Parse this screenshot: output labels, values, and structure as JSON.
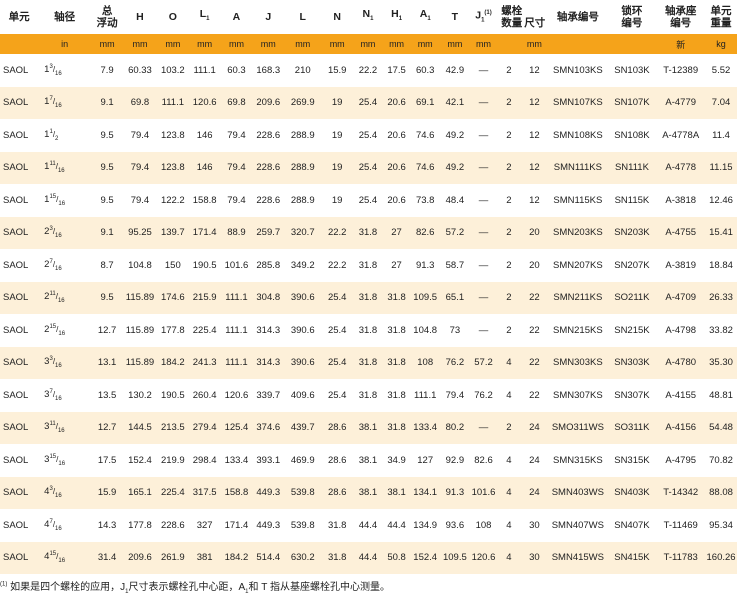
{
  "headers": {
    "unit": "单元",
    "bore": "轴径",
    "float": "总\n浮动",
    "H": "H",
    "O": "O",
    "L1": "L",
    "A": "A",
    "J": "J",
    "L": "L",
    "N": "N",
    "N1": "N",
    "H1": "H",
    "A1": "A",
    "T": "T",
    "J1": "J",
    "J1_sup": "(1)",
    "bolt_count": "螺栓\n数量",
    "bolt_size": "尺寸",
    "bearing": "轴承编号",
    "lock_ring": "锁环\n编号",
    "housing": "轴承座\n编号",
    "unit_weight": "单元\n重量",
    "sub1": "1"
  },
  "units": {
    "in": "in",
    "mm": "mm",
    "housing_new": "新",
    "kg": "kg"
  },
  "rows": [
    {
      "unit": "SAOL",
      "bore_whole": "1",
      "bore_num": "3",
      "bore_den": "16",
      "float": "7.9",
      "H": "60.33",
      "O": "103.2",
      "L1": "111.1",
      "A": "60.3",
      "J": "168.3",
      "L": "210",
      "N": "15.9",
      "N1": "22.2",
      "H1": "17.5",
      "A1": "60.3",
      "T": "42.9",
      "J1": "—",
      "bolt_count": "2",
      "bolt_size": "12",
      "bearing": "SMN103KS",
      "lock_ring": "SN103K",
      "housing": "T-12389",
      "weight": "5.52"
    },
    {
      "unit": "SAOL",
      "bore_whole": "1",
      "bore_num": "7",
      "bore_den": "16",
      "float": "9.1",
      "H": "69.8",
      "O": "111.1",
      "L1": "120.6",
      "A": "69.8",
      "J": "209.6",
      "L": "269.9",
      "N": "19",
      "N1": "25.4",
      "H1": "20.6",
      "A1": "69.1",
      "T": "42.1",
      "J1": "—",
      "bolt_count": "2",
      "bolt_size": "12",
      "bearing": "SMN107KS",
      "lock_ring": "SN107K",
      "housing": "A-4779",
      "weight": "7.04"
    },
    {
      "unit": "SAOL",
      "bore_whole": "1",
      "bore_num": "1",
      "bore_den": "2",
      "float": "9.5",
      "H": "79.4",
      "O": "123.8",
      "L1": "146",
      "A": "79.4",
      "J": "228.6",
      "L": "288.9",
      "N": "19",
      "N1": "25.4",
      "H1": "20.6",
      "A1": "74.6",
      "T": "49.2",
      "J1": "—",
      "bolt_count": "2",
      "bolt_size": "12",
      "bearing": "SMN108KS",
      "lock_ring": "SN108K",
      "housing": "A-4778A",
      "weight": "11.4"
    },
    {
      "unit": "SAOL",
      "bore_whole": "1",
      "bore_num": "11",
      "bore_den": "16",
      "float": "9.5",
      "H": "79.4",
      "O": "123.8",
      "L1": "146",
      "A": "79.4",
      "J": "228.6",
      "L": "288.9",
      "N": "19",
      "N1": "25.4",
      "H1": "20.6",
      "A1": "74.6",
      "T": "49.2",
      "J1": "—",
      "bolt_count": "2",
      "bolt_size": "12",
      "bearing": "SMN111KS",
      "lock_ring": "SN111K",
      "housing": "A-4778",
      "weight": "11.15"
    },
    {
      "unit": "SAOL",
      "bore_whole": "1",
      "bore_num": "15",
      "bore_den": "16",
      "float": "9.5",
      "H": "79.4",
      "O": "122.2",
      "L1": "158.8",
      "A": "79.4",
      "J": "228.6",
      "L": "288.9",
      "N": "19",
      "N1": "25.4",
      "H1": "20.6",
      "A1": "73.8",
      "T": "48.4",
      "J1": "—",
      "bolt_count": "2",
      "bolt_size": "12",
      "bearing": "SMN115KS",
      "lock_ring": "SN115K",
      "housing": "A-3818",
      "weight": "12.46"
    },
    {
      "unit": "SAOL",
      "bore_whole": "2",
      "bore_num": "3",
      "bore_den": "16",
      "float": "9.1",
      "H": "95.25",
      "O": "139.7",
      "L1": "171.4",
      "A": "88.9",
      "J": "259.7",
      "L": "320.7",
      "N": "22.2",
      "N1": "31.8",
      "H1": "27",
      "A1": "82.6",
      "T": "57.2",
      "J1": "—",
      "bolt_count": "2",
      "bolt_size": "20",
      "bearing": "SMN203KS",
      "lock_ring": "SN203K",
      "housing": "A-4755",
      "weight": "15.41"
    },
    {
      "unit": "SAOL",
      "bore_whole": "2",
      "bore_num": "7",
      "bore_den": "16",
      "float": "8.7",
      "H": "104.8",
      "O": "150",
      "L1": "190.5",
      "A": "101.6",
      "J": "285.8",
      "L": "349.2",
      "N": "22.2",
      "N1": "31.8",
      "H1": "27",
      "A1": "91.3",
      "T": "58.7",
      "J1": "—",
      "bolt_count": "2",
      "bolt_size": "20",
      "bearing": "SMN207KS",
      "lock_ring": "SN207K",
      "housing": "A-3819",
      "weight": "18.84"
    },
    {
      "unit": "SAOL",
      "bore_whole": "2",
      "bore_num": "11",
      "bore_den": "16",
      "float": "9.5",
      "H": "115.89",
      "O": "174.6",
      "L1": "215.9",
      "A": "111.1",
      "J": "304.8",
      "L": "390.6",
      "N": "25.4",
      "N1": "31.8",
      "H1": "31.8",
      "A1": "109.5",
      "T": "65.1",
      "J1": "—",
      "bolt_count": "2",
      "bolt_size": "22",
      "bearing": "SMN211KS",
      "lock_ring": "SO211K",
      "housing": "A-4709",
      "weight": "26.33"
    },
    {
      "unit": "SAOL",
      "bore_whole": "2",
      "bore_num": "15",
      "bore_den": "16",
      "float": "12.7",
      "H": "115.89",
      "O": "177.8",
      "L1": "225.4",
      "A": "111.1",
      "J": "314.3",
      "L": "390.6",
      "N": "25.4",
      "N1": "31.8",
      "H1": "31.8",
      "A1": "104.8",
      "T": "73",
      "J1": "—",
      "bolt_count": "2",
      "bolt_size": "22",
      "bearing": "SMN215KS",
      "lock_ring": "SN215K",
      "housing": "A-4798",
      "weight": "33.82"
    },
    {
      "unit": "SAOL",
      "bore_whole": "3",
      "bore_num": "3",
      "bore_den": "16",
      "float": "13.1",
      "H": "115.89",
      "O": "184.2",
      "L1": "241.3",
      "A": "111.1",
      "J": "314.3",
      "L": "390.6",
      "N": "25.4",
      "N1": "31.8",
      "H1": "31.8",
      "A1": "108",
      "T": "76.2",
      "J1": "57.2",
      "bolt_count": "4",
      "bolt_size": "22",
      "bearing": "SMN303KS",
      "lock_ring": "SN303K",
      "housing": "A-4780",
      "weight": "35.30"
    },
    {
      "unit": "SAOL",
      "bore_whole": "3",
      "bore_num": "7",
      "bore_den": "16",
      "float": "13.5",
      "H": "130.2",
      "O": "190.5",
      "L1": "260.4",
      "A": "120.6",
      "J": "339.7",
      "L": "409.6",
      "N": "25.4",
      "N1": "31.8",
      "H1": "31.8",
      "A1": "111.1",
      "T": "79.4",
      "J1": "76.2",
      "bolt_count": "4",
      "bolt_size": "22",
      "bearing": "SMN307KS",
      "lock_ring": "SN307K",
      "housing": "A-4155",
      "weight": "48.81"
    },
    {
      "unit": "SAOL",
      "bore_whole": "3",
      "bore_num": "11",
      "bore_den": "16",
      "float": "12.7",
      "H": "144.5",
      "O": "213.5",
      "L1": "279.4",
      "A": "125.4",
      "J": "374.6",
      "L": "439.7",
      "N": "28.6",
      "N1": "38.1",
      "H1": "31.8",
      "A1": "133.4",
      "T": "80.2",
      "J1": "—",
      "bolt_count": "2",
      "bolt_size": "24",
      "bearing": "SMO311WS",
      "lock_ring": "SO311K",
      "housing": "A-4156",
      "weight": "54.48"
    },
    {
      "unit": "SAOL",
      "bore_whole": "3",
      "bore_num": "15",
      "bore_den": "16",
      "float": "17.5",
      "H": "152.4",
      "O": "219.9",
      "L1": "298.4",
      "A": "133.4",
      "J": "393.1",
      "L": "469.9",
      "N": "28.6",
      "N1": "38.1",
      "H1": "34.9",
      "A1": "127",
      "T": "92.9",
      "J1": "82.6",
      "bolt_count": "4",
      "bolt_size": "24",
      "bearing": "SMN315KS",
      "lock_ring": "SN315K",
      "housing": "A-4795",
      "weight": "70.82"
    },
    {
      "unit": "SAOL",
      "bore_whole": "4",
      "bore_num": "3",
      "bore_den": "16",
      "float": "15.9",
      "H": "165.1",
      "O": "225.4",
      "L1": "317.5",
      "A": "158.8",
      "J": "449.3",
      "L": "539.8",
      "N": "28.6",
      "N1": "38.1",
      "H1": "38.1",
      "A1": "134.1",
      "T": "91.3",
      "J1": "101.6",
      "bolt_count": "4",
      "bolt_size": "24",
      "bearing": "SMN403WS",
      "lock_ring": "SN403K",
      "housing": "T-14342",
      "weight": "88.08"
    },
    {
      "unit": "SAOL",
      "bore_whole": "4",
      "bore_num": "7",
      "bore_den": "16",
      "float": "14.3",
      "H": "177.8",
      "O": "228.6",
      "L1": "327",
      "A": "171.4",
      "J": "449.3",
      "L": "539.8",
      "N": "31.8",
      "N1": "44.4",
      "H1": "44.4",
      "A1": "134.9",
      "T": "93.6",
      "J1": "108",
      "bolt_count": "4",
      "bolt_size": "30",
      "bearing": "SMN407WS",
      "lock_ring": "SN407K",
      "housing": "T-11469",
      "weight": "95.34"
    },
    {
      "unit": "SAOL",
      "bore_whole": "4",
      "bore_num": "15",
      "bore_den": "16",
      "float": "31.4",
      "H": "209.6",
      "O": "261.9",
      "L1": "381",
      "A": "184.2",
      "J": "514.4",
      "L": "630.2",
      "N": "31.8",
      "N1": "44.4",
      "H1": "50.8",
      "A1": "152.4",
      "T": "109.5",
      "J1": "120.6",
      "bolt_count": "4",
      "bolt_size": "30",
      "bearing": "SMN415WS",
      "lock_ring": "SN415K",
      "housing": "T-11783",
      "weight": "160.26"
    }
  ],
  "footnote": {
    "mark": "(1)",
    "text_a": "如果是四个螺栓的应用，J",
    "sub": "1",
    "text_b": "尺寸表示螺栓孔中心距，A",
    "sub2": "1",
    "text_c": "和 T 指从基座螺栓孔中心测量。"
  }
}
